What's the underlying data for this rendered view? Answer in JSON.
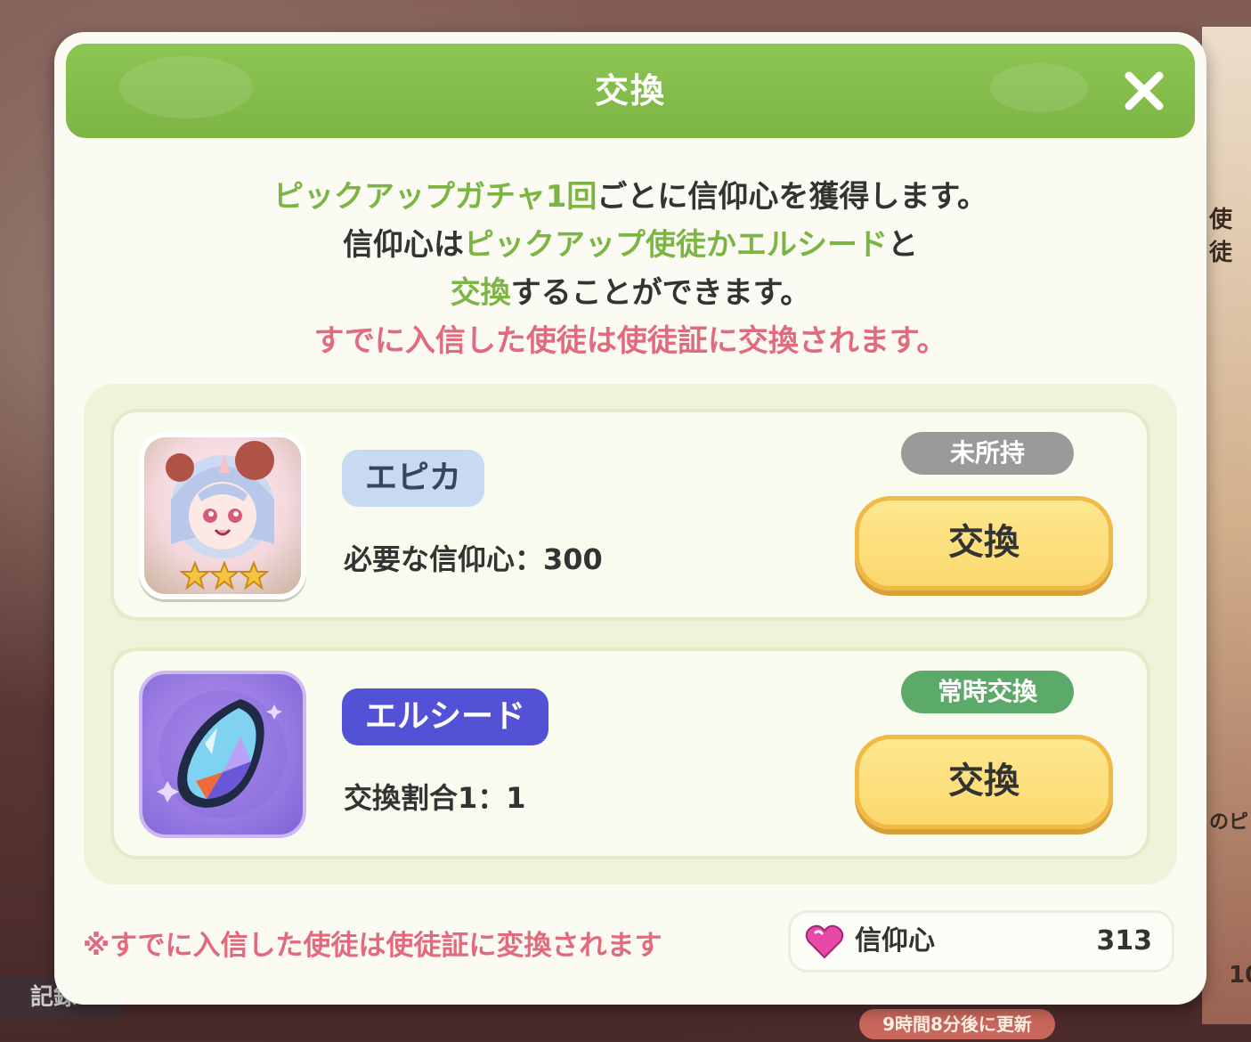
{
  "modal": {
    "title": "交換",
    "description": {
      "line1_green": "ピックアップガチャ1回",
      "line1_dark": "ごとに信仰心を獲得します。",
      "line2_dark_a": "信仰心は",
      "line2_green": "ピックアップ使徒かエルシード",
      "line2_dark_b": "と",
      "line3_green": "交換",
      "line3_dark": "することができます。",
      "line4_red": "すでに入信した使徒は使徒証に交換されます。"
    },
    "items": [
      {
        "badge": "エピカ",
        "detail": "必要な信仰心：300",
        "status": "未所持",
        "button": "交換",
        "stars": 3
      },
      {
        "badge": "エルシード",
        "detail": "交換割合1：1",
        "status": "常時交換",
        "button": "交換"
      }
    ],
    "footer_note": "※すでに入信した使徒は使徒証に変換されます",
    "currency": {
      "label": "信仰心",
      "value": "313",
      "icon": "heart-gem-icon"
    }
  },
  "background": {
    "record_label": "記録",
    "refresh_label": "9時間8分後に更新",
    "side_text_1": "使徒",
    "side_text_2": "のピ",
    "side_text_3": "10"
  },
  "colors": {
    "header_green": "#8cc553",
    "accent_green": "#7db545",
    "warning_red": "#e26a7d",
    "button_yellow": "#fbd86e",
    "elseed_badge": "#5352d6",
    "rarity_badge": "#c8daf1",
    "status_gray": "#9a9a9a",
    "status_green": "#5caa6a"
  }
}
